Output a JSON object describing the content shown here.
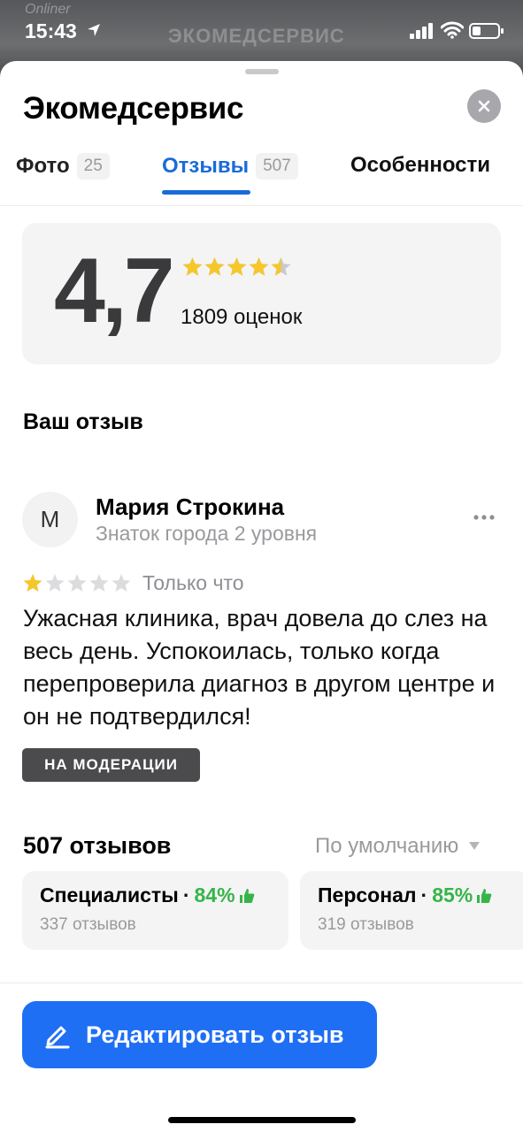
{
  "status_bar": {
    "time": "15:43"
  },
  "background": {
    "sign_text": "ЭКОМЕДСЕРВИС",
    "watermark": "Onliner"
  },
  "header": {
    "title": "Экомедсервис"
  },
  "tabs": [
    {
      "label": "Фото",
      "count": "25"
    },
    {
      "label": "Отзывы",
      "count": "507",
      "active": true
    },
    {
      "label": "Особенности"
    }
  ],
  "rating": {
    "value": "4,7",
    "stars": 4.5,
    "count_text": "1809 оценок"
  },
  "your_review": {
    "section_title": "Ваш отзыв",
    "avatar_letter": "М",
    "author": "Мария Строкина",
    "level": "Знаток города 2 уровня",
    "stars": 1,
    "time": "Только что",
    "text": "Ужасная клиника, врач довела до слез на весь день. Успокоилась, только когда перепроверила диагноз в другом центре и он не подтвердился!",
    "badge": "НА МОДЕРАЦИИ"
  },
  "reviews": {
    "count_text": "507 отзывов",
    "sort_label": "По умолчанию",
    "aspects": [
      {
        "name": "Специалисты",
        "percent": "84%",
        "sub": "337 отзывов"
      },
      {
        "name": "Персонал",
        "percent": "85%",
        "sub": "319 отзывов"
      }
    ]
  },
  "actions": {
    "edit_label": "Редактировать отзыв"
  },
  "colors": {
    "accent": "#1f6ff5",
    "tab_active": "#1a6bd9",
    "positive": "#36b449",
    "star": "#f5c72a"
  }
}
